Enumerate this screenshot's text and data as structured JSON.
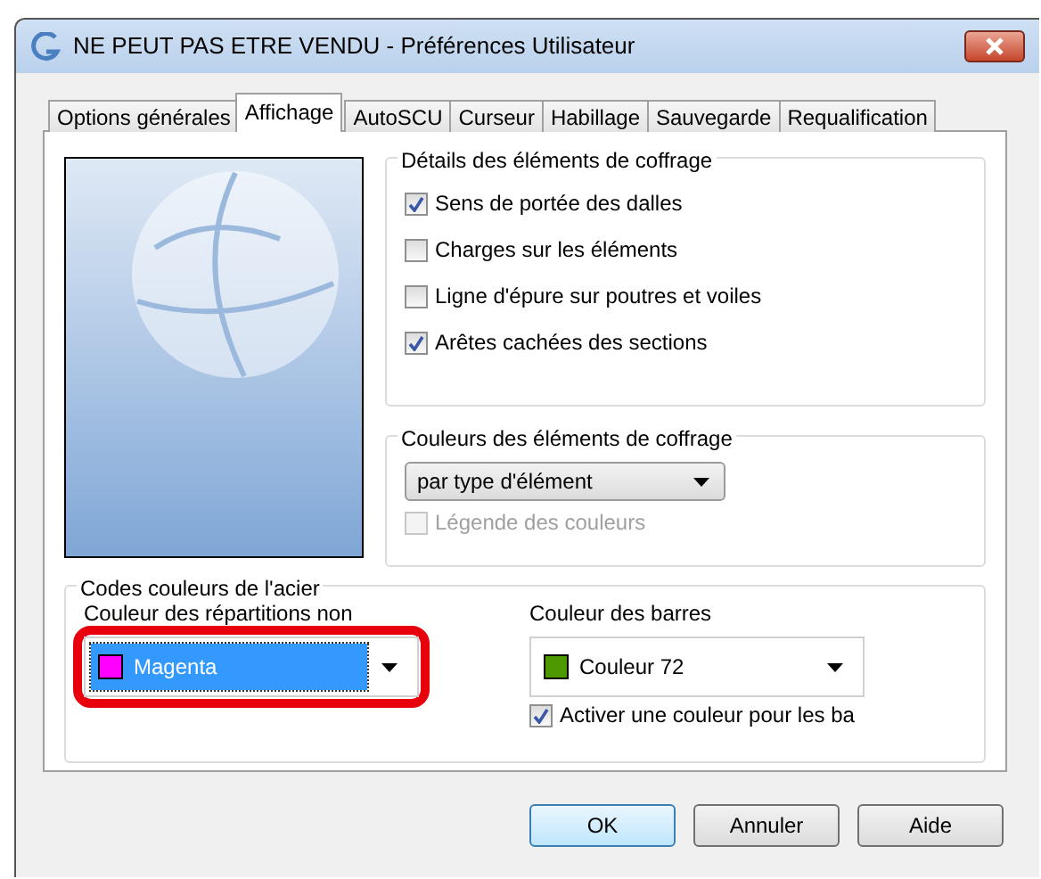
{
  "window": {
    "title": "NE PEUT PAS ETRE VENDU - Préférences Utilisateur"
  },
  "tabs": [
    {
      "label": "Options générales",
      "selected": false
    },
    {
      "label": "Affichage",
      "selected": true
    },
    {
      "label": "AutoSCU",
      "selected": false
    },
    {
      "label": "Curseur",
      "selected": false
    },
    {
      "label": "Habillage",
      "selected": false
    },
    {
      "label": "Sauvegarde",
      "selected": false
    },
    {
      "label": "Requalification",
      "selected": false
    }
  ],
  "details_group": {
    "title": "Détails des éléments de coffrage",
    "checkboxes": [
      {
        "label": "Sens de portée des dalles",
        "checked": true
      },
      {
        "label": "Charges sur les éléments",
        "checked": false
      },
      {
        "label": "Ligne d'épure sur poutres et voiles",
        "checked": false
      },
      {
        "label": "Arêtes cachées des sections",
        "checked": true
      }
    ]
  },
  "colors_group": {
    "title": "Couleurs des éléments de coffrage",
    "dropdown": {
      "value": "par type d'élément"
    },
    "legend_checkbox": {
      "label": "Légende des couleurs",
      "checked": false,
      "disabled": true
    }
  },
  "steel_group": {
    "title": "Codes couleurs de l'acier",
    "left": {
      "label": "Couleur des répartitions non",
      "dropdown": {
        "value": "Magenta",
        "color": "#ff00ff",
        "selected": true
      },
      "highlighted": true
    },
    "right": {
      "label": "Couleur des barres",
      "dropdown": {
        "value": "Couleur 72",
        "color": "#4c9a00",
        "selected": false
      },
      "checkbox": {
        "label": "Activer une couleur pour les ba",
        "checked": true
      }
    }
  },
  "buttons": [
    {
      "label": "OK",
      "default": true
    },
    {
      "label": "Annuler",
      "default": false
    },
    {
      "label": "Aide",
      "default": false
    }
  ]
}
